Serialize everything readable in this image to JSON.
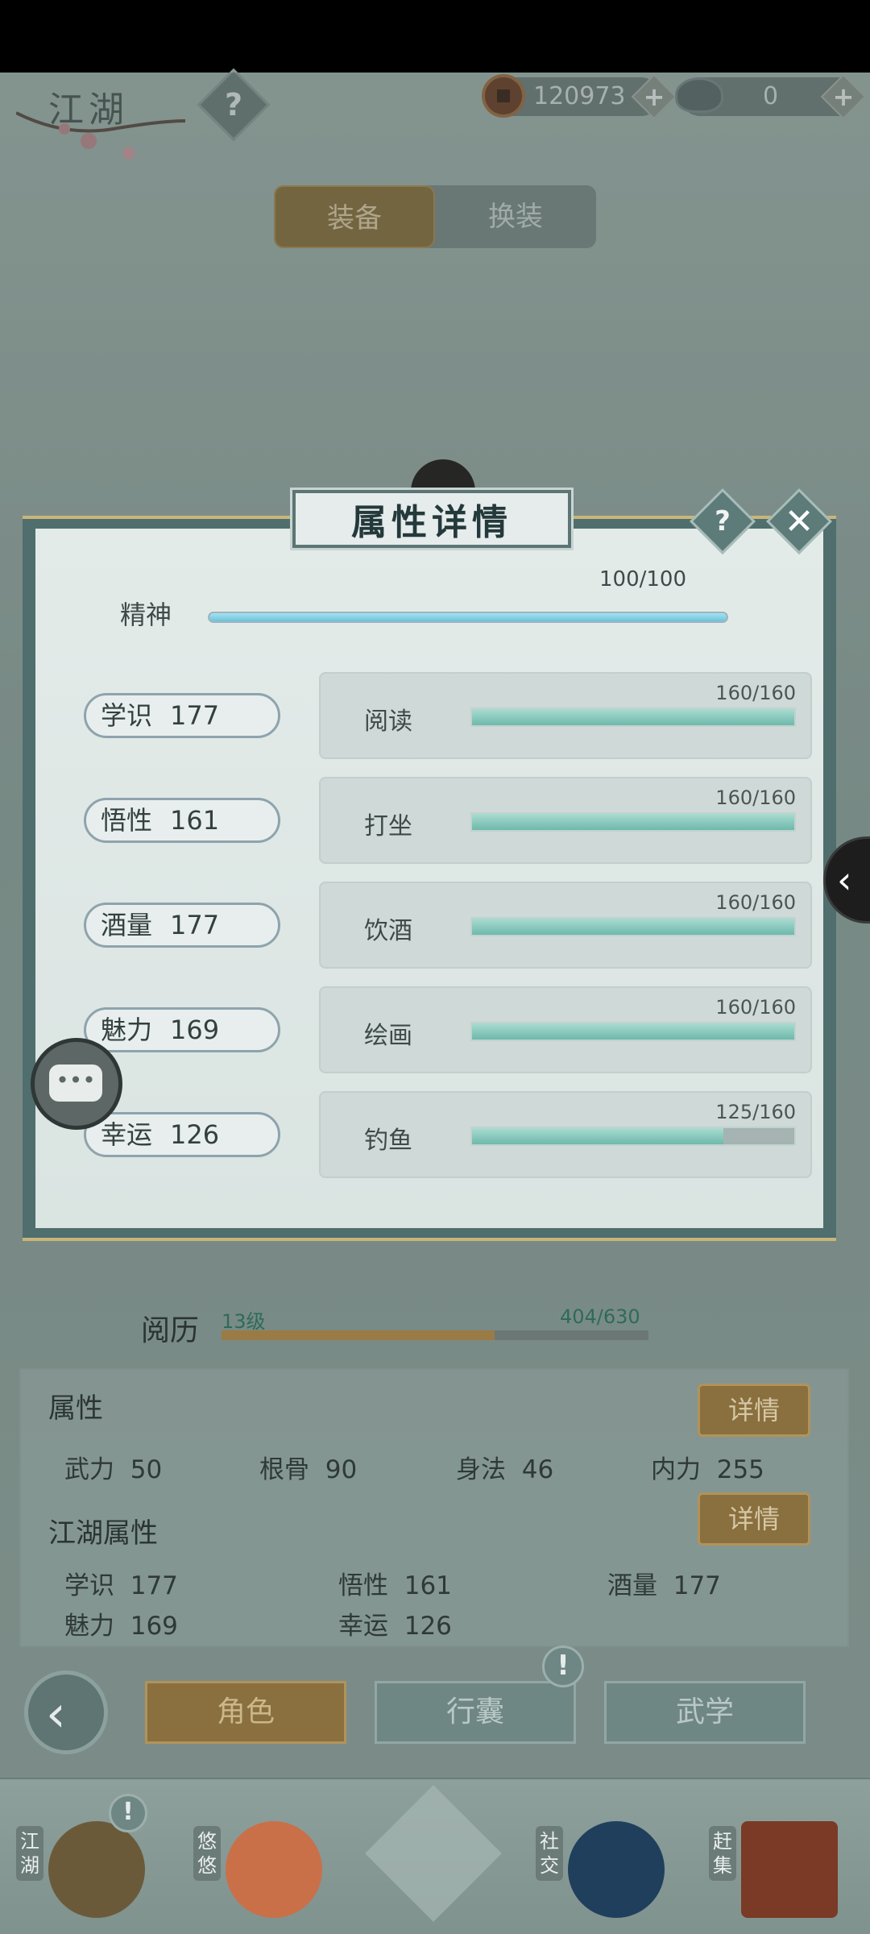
{
  "top_bar": {
    "region": "江湖",
    "help_icon": "question-icon",
    "coins": "120973",
    "silver": "0",
    "plus": "+"
  },
  "equip_tabs": [
    {
      "label": "装备",
      "active": true
    },
    {
      "label": "换装",
      "active": false
    }
  ],
  "modal": {
    "title": "属性详情",
    "help": "?",
    "close": "✕",
    "spirit": {
      "label": "精神",
      "value_text": "100/100",
      "fraction": 1.0
    },
    "rows": [
      {
        "attr": "学识",
        "attr_value": "177",
        "activity": "阅读",
        "value_text": "160/160",
        "fraction": 1.0
      },
      {
        "attr": "悟性",
        "attr_value": "161",
        "activity": "打坐",
        "value_text": "160/160",
        "fraction": 1.0
      },
      {
        "attr": "酒量",
        "attr_value": "177",
        "activity": "饮酒",
        "value_text": "160/160",
        "fraction": 1.0
      },
      {
        "attr": "魅力",
        "attr_value": "169",
        "activity": "绘画",
        "value_text": "160/160",
        "fraction": 1.0
      },
      {
        "attr": "幸运",
        "attr_value": "126",
        "activity": "钓鱼",
        "value_text": "125/160",
        "fraction": 0.78
      }
    ]
  },
  "side_tab_icon": "chevron-left-icon",
  "side_tab_glyph": "‹",
  "chat_glyph": "•••",
  "experience": {
    "label": "阅历",
    "level": "13级",
    "value_text": "404/630",
    "fraction": 0.64
  },
  "attributes": {
    "title": "属性",
    "detail_label": "详情",
    "stats": [
      {
        "name": "武力",
        "value": "50"
      },
      {
        "name": "根骨",
        "value": "90"
      },
      {
        "name": "身法",
        "value": "46"
      },
      {
        "name": "内力",
        "value": "255"
      }
    ],
    "jianghu_title": "江湖属性",
    "jianghu_detail_label": "详情",
    "jianghu_stats": [
      {
        "name": "学识",
        "value": "177"
      },
      {
        "name": "悟性",
        "value": "161"
      },
      {
        "name": "酒量",
        "value": "177"
      },
      {
        "name": "魅力",
        "value": "169"
      },
      {
        "name": "幸运",
        "value": "126"
      }
    ]
  },
  "nav_tabs": [
    {
      "label": "角色",
      "active": true
    },
    {
      "label": "行囊",
      "active": false,
      "alert": "!"
    },
    {
      "label": "武学",
      "active": false
    }
  ],
  "back_glyph": "‹",
  "dock": [
    {
      "label": "江湖",
      "alert": "!"
    },
    {
      "label": "悠悠"
    },
    {
      "label": ""
    },
    {
      "label": "社交"
    },
    {
      "label": "赶集"
    }
  ],
  "colors": {
    "accent_gold": "#8a6f3f",
    "teal": "#4f6e6d",
    "bar_teal": "#6db9ab",
    "bar_blue": "#6cc3dc"
  }
}
